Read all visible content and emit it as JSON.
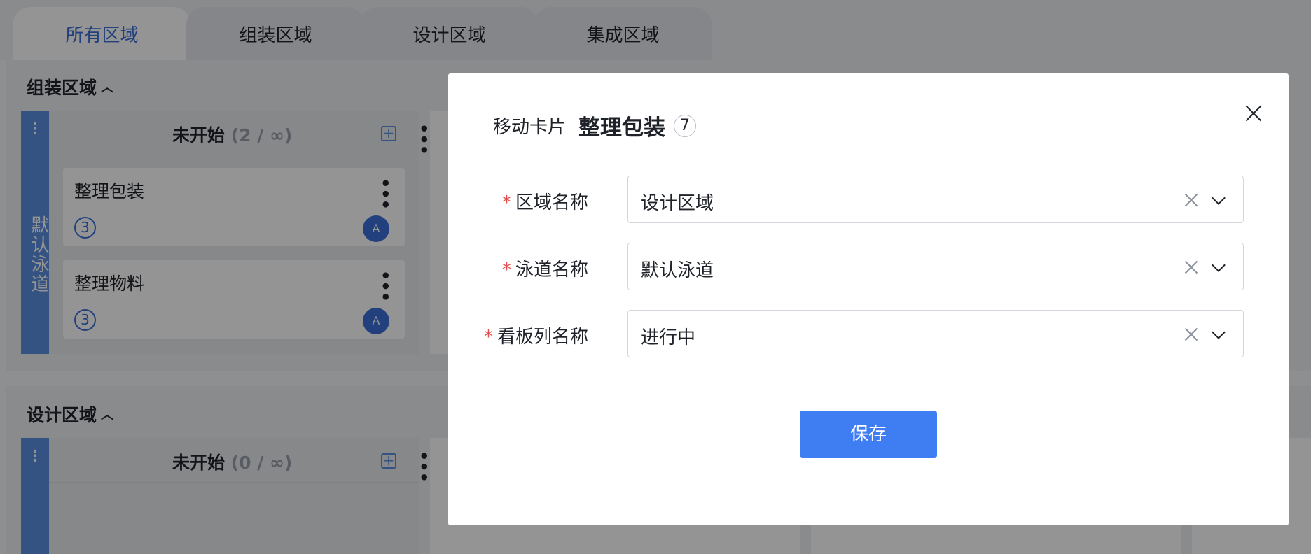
{
  "tabs": [
    {
      "label": "所有区域",
      "active": true
    },
    {
      "label": "组装区域",
      "active": false
    },
    {
      "label": "设计区域",
      "active": false
    },
    {
      "label": "集成区域",
      "active": false
    }
  ],
  "board": {
    "sections": [
      {
        "title": "组装区域",
        "lane_name": "默认泳道",
        "column": {
          "title": "未开始",
          "count": "(2 / ∞)"
        },
        "cards": [
          {
            "title": "整理包装",
            "badge": "3",
            "avatar": "A"
          },
          {
            "title": "整理物料",
            "badge": "3",
            "avatar": "A"
          }
        ]
      },
      {
        "title": "设计区域",
        "column": {
          "title": "未开始",
          "count": "(0 / ∞)"
        }
      }
    ]
  },
  "modal": {
    "label": "移动卡片",
    "card_name": "整理包装",
    "card_number": "7",
    "fields": [
      {
        "label": "区域名称",
        "value": "设计区域",
        "required_mark": "*"
      },
      {
        "label": "泳道名称",
        "value": "默认泳道",
        "required_mark": "*"
      },
      {
        "label": "看板列名称",
        "value": "进行中",
        "required_mark": "*"
      }
    ],
    "save_label": "保存"
  },
  "colors": {
    "accent": "#3f7ef2",
    "lane": "#5b8ee0",
    "required": "#e34d4d"
  }
}
